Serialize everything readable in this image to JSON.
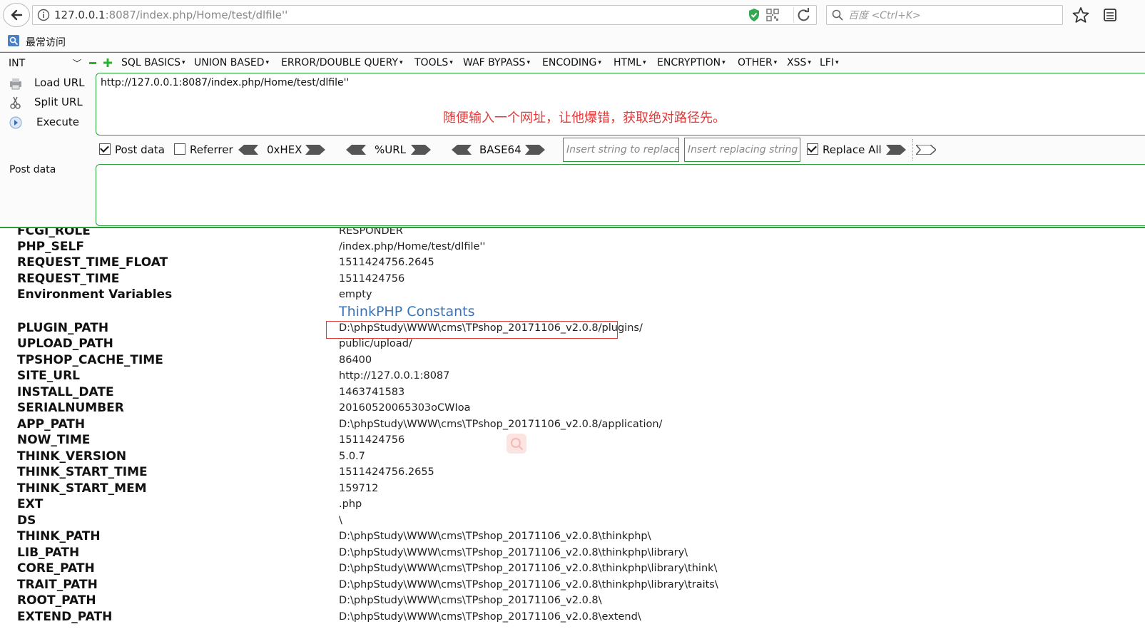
{
  "browser": {
    "url_host": "127.0.0.1",
    "url_rest": ":8087/index.php/Home/test/dlfile''",
    "search_placeholder": "百度 <Ctrl+K>"
  },
  "bookmarks": {
    "label": "最常访问"
  },
  "hackbar": {
    "type_select": "INT",
    "menus": [
      "SQL BASICS",
      "UNION BASED",
      "ERROR/DOUBLE QUERY",
      "TOOLS",
      "WAF BYPASS",
      "ENCODING",
      "HTML",
      "ENCRYPTION",
      "OTHER",
      "XSS",
      "LFI"
    ],
    "load_url": "Load URL",
    "split_url": "Split URL",
    "execute": "Execute",
    "url_value": "http://127.0.0.1:8087/index.php/Home/test/dlfile''",
    "annotation": "随便输入一个网址，让他爆错，获取绝对路径先。",
    "post_data_check": "Post data",
    "post_data_checked": true,
    "referrer_check": "Referrer",
    "referrer_checked": false,
    "enc_hex": "0xHEX",
    "enc_url": "%URL",
    "enc_base64": "BASE64",
    "replace_placeholder": "Insert string to replace",
    "replacing_placeholder": "Insert replacing string",
    "replace_all": "Replace All",
    "replace_all_checked": true,
    "post_data_label": "Post data"
  },
  "content": {
    "section_title": "ThinkPHP Constants",
    "rows_before": [
      {
        "k": "FCGI_ROLE",
        "v": "RESPONDER"
      },
      {
        "k": "PHP_SELF",
        "v": "/index.php/Home/test/dlfile''"
      },
      {
        "k": "REQUEST_TIME_FLOAT",
        "v": "1511424756.2645"
      },
      {
        "k": "REQUEST_TIME",
        "v": "1511424756"
      },
      {
        "k": "Environment Variables",
        "v": "empty"
      }
    ],
    "rows_after": [
      {
        "k": "PLUGIN_PATH",
        "v": "D:\\phpStudy\\WWW\\cms\\TPshop_20171106_v2.0.8/plugins/"
      },
      {
        "k": "UPLOAD_PATH",
        "v": "public/upload/"
      },
      {
        "k": "TPSHOP_CACHE_TIME",
        "v": "86400"
      },
      {
        "k": "SITE_URL",
        "v": "http://127.0.0.1:8087"
      },
      {
        "k": "INSTALL_DATE",
        "v": "1463741583"
      },
      {
        "k": "SERIALNUMBER",
        "v": "20160520065303oCWIoa"
      },
      {
        "k": "APP_PATH",
        "v": "D:\\phpStudy\\WWW\\cms\\TPshop_20171106_v2.0.8/application/"
      },
      {
        "k": "NOW_TIME",
        "v": "1511424756"
      },
      {
        "k": "THINK_VERSION",
        "v": "5.0.7"
      },
      {
        "k": "THINK_START_TIME",
        "v": "1511424756.2655"
      },
      {
        "k": "THINK_START_MEM",
        "v": "159712"
      },
      {
        "k": "EXT",
        "v": ".php"
      },
      {
        "k": "DS",
        "v": "\\"
      },
      {
        "k": "THINK_PATH",
        "v": "D:\\phpStudy\\WWW\\cms\\TPshop_20171106_v2.0.8\\thinkphp\\"
      },
      {
        "k": "LIB_PATH",
        "v": "D:\\phpStudy\\WWW\\cms\\TPshop_20171106_v2.0.8\\thinkphp\\library\\"
      },
      {
        "k": "CORE_PATH",
        "v": "D:\\phpStudy\\WWW\\cms\\TPshop_20171106_v2.0.8\\thinkphp\\library\\think\\"
      },
      {
        "k": "TRAIT_PATH",
        "v": "D:\\phpStudy\\WWW\\cms\\TPshop_20171106_v2.0.8\\thinkphp\\library\\traits\\"
      },
      {
        "k": "ROOT_PATH",
        "v": "D:\\phpStudy\\WWW\\cms\\TPshop_20171106_v2.0.8\\"
      },
      {
        "k": "EXTEND_PATH",
        "v": "D:\\phpStudy\\WWW\\cms\\TPshop_20171106_v2.0.8\\extend\\"
      }
    ]
  },
  "colors": {
    "hackbar_green": "#2c9b3a",
    "annotation_red": "#e23a3a",
    "section_blue": "#3a73b6"
  }
}
